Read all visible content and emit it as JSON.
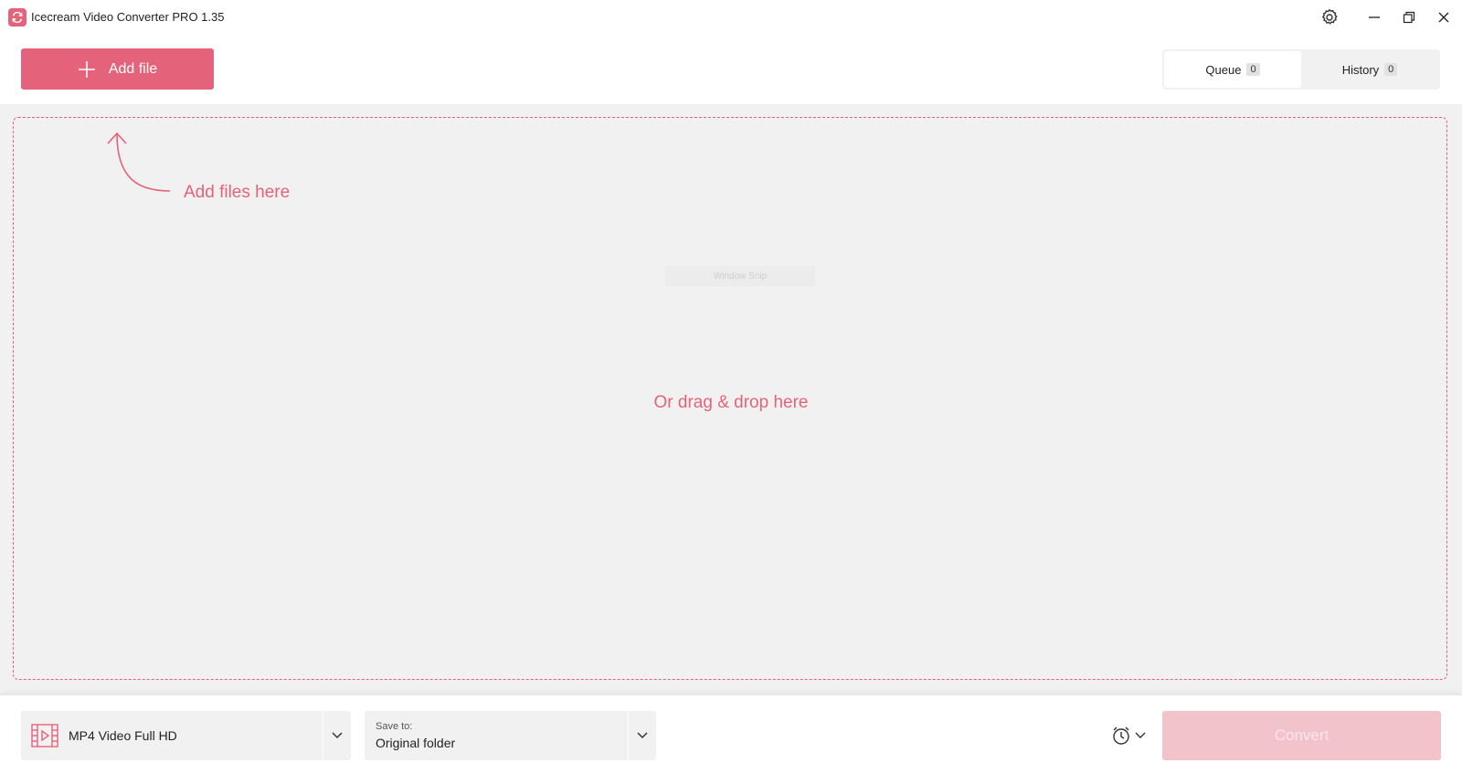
{
  "window": {
    "title": "Icecream Video Converter PRO 1.35",
    "icons": [
      "app-logo-icon",
      "settings-gear-icon",
      "minimize-icon",
      "restore-icon",
      "close-icon"
    ]
  },
  "toolbar": {
    "add_file_label": "Add file",
    "tabs": [
      {
        "label": "Queue",
        "count": "0",
        "active": true
      },
      {
        "label": "History",
        "count": "0",
        "active": false
      }
    ]
  },
  "dropzone": {
    "hint_add": "Add files here",
    "hint_drag": "Or drag & drop here",
    "snip_overlay": "Window Snip"
  },
  "footer": {
    "format_label": "MP4 Video Full HD",
    "save_to_caption": "Save to:",
    "save_to_value": "Original folder",
    "convert_label": "Convert"
  },
  "colors": {
    "accent": "#e5637a",
    "convert_disabled": "#f3c3cc",
    "background": "#f1f1f1"
  }
}
